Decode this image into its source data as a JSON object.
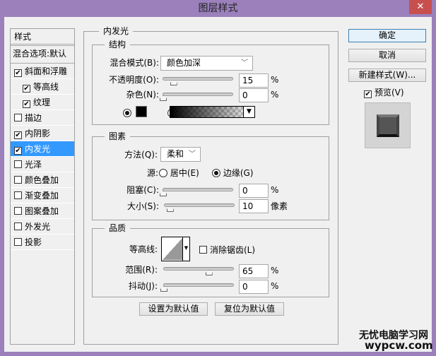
{
  "window": {
    "title": "图层样式",
    "close": "✕"
  },
  "styles_list": {
    "header": "样式",
    "blend_options": "混合选项:默认",
    "items": [
      {
        "label": "斜面和浮雕",
        "checked": true,
        "indent": false
      },
      {
        "label": "等高线",
        "checked": true,
        "indent": true
      },
      {
        "label": "纹理",
        "checked": true,
        "indent": true
      },
      {
        "label": "描边",
        "checked": false,
        "indent": false
      },
      {
        "label": "内阴影",
        "checked": true,
        "indent": false
      },
      {
        "label": "内发光",
        "checked": true,
        "indent": false,
        "selected": true
      },
      {
        "label": "光泽",
        "checked": false,
        "indent": false
      },
      {
        "label": "颜色叠加",
        "checked": false,
        "indent": false
      },
      {
        "label": "渐变叠加",
        "checked": false,
        "indent": false
      },
      {
        "label": "图案叠加",
        "checked": false,
        "indent": false
      },
      {
        "label": "外发光",
        "checked": false,
        "indent": false
      },
      {
        "label": "投影",
        "checked": false,
        "indent": false
      }
    ]
  },
  "panel": {
    "title": "内发光",
    "structure": {
      "title": "结构",
      "blend_label": "混合模式(B):",
      "blend_value": "颜色加深",
      "opacity_label": "不透明度(O):",
      "opacity": "15",
      "noise_label": "杂色(N):",
      "noise": "0",
      "unit": "%"
    },
    "elements": {
      "title": "图素",
      "method_label": "方法(Q):",
      "method_value": "柔和",
      "source_label": "源:",
      "center": "居中(E)",
      "edge": "边缘(G)",
      "choke_label": "阻塞(C):",
      "choke": "0",
      "size_label": "大小(S):",
      "size": "10",
      "size_unit": "像素",
      "unit": "%"
    },
    "quality": {
      "title": "品质",
      "contour_label": "等高线:",
      "antialias": "消除锯齿(L)",
      "range_label": "范围(R):",
      "range": "65",
      "jitter_label": "抖动(J):",
      "jitter": "0",
      "unit": "%"
    },
    "make_default": "设置为默认值",
    "reset_default": "复位为默认值"
  },
  "right": {
    "ok": "确定",
    "cancel": "取消",
    "new_style": "新建样式(W)...",
    "preview": "预览(V)"
  },
  "watermark": {
    "line1": "无忧电脑学习网",
    "line2": "wypcw.com"
  }
}
